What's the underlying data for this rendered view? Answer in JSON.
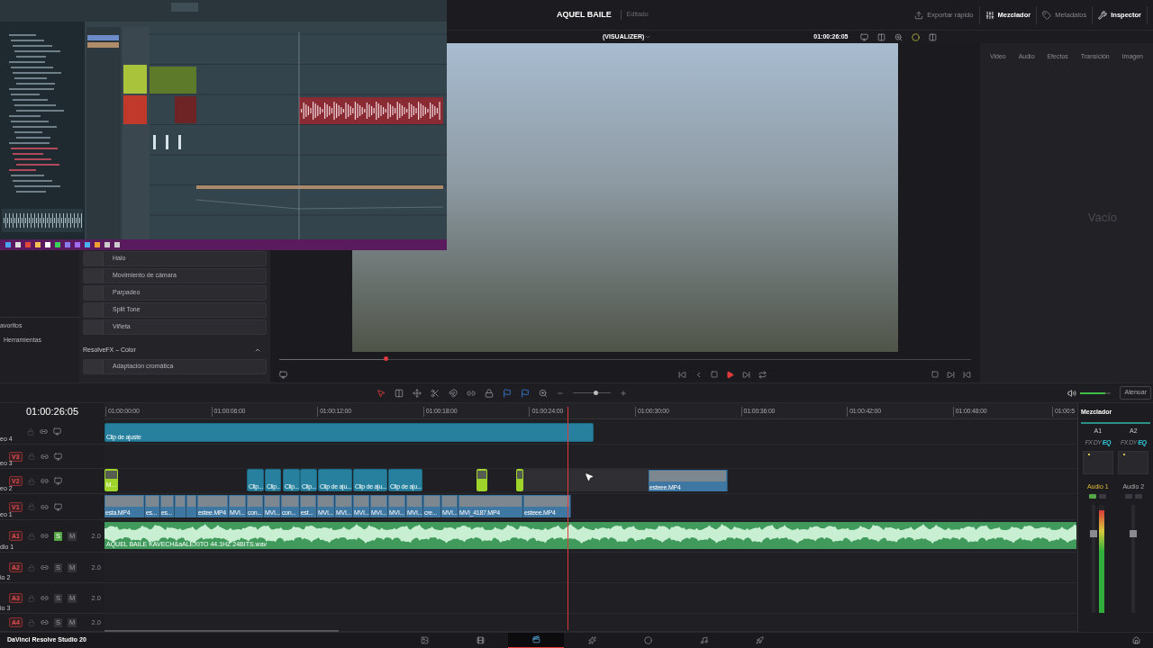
{
  "project": {
    "title": "AQUEL BAILE",
    "status": "Editado"
  },
  "header_buttons": [
    {
      "kind": "export",
      "label": "Exportar rápido",
      "selected": false
    },
    {
      "kind": "mixer",
      "label": "Mezclador",
      "selected": true
    },
    {
      "kind": "metadata",
      "label": "Metadatos",
      "selected": false
    },
    {
      "kind": "inspector",
      "label": "Inspector",
      "selected": true
    }
  ],
  "viewer": {
    "title": "(VISUALIZER)",
    "timecode": "01:00:26:05",
    "scrub": {
      "level": 0.154
    }
  },
  "sidebar": [
    "avoritos",
    "Herramientas"
  ],
  "effects": {
    "items": [
      "Halo",
      "Movimiento de cámara",
      "Parpadeo",
      "Split Tone",
      "Viñeta"
    ],
    "section": "ResolveFX – Color",
    "section_items": [
      "Adaptación cromática"
    ]
  },
  "inspector": {
    "tabs": [
      "Video",
      "Audio",
      "Efectos",
      "Transición",
      "Imagen"
    ],
    "empty_text": "Vacío"
  },
  "toolbar": {
    "tools": [
      {
        "kind": "select",
        "selected": true
      },
      {
        "kind": "trim",
        "selected": false
      },
      {
        "kind": "dynamic",
        "selected": false
      },
      {
        "kind": "blade",
        "selected": false
      }
    ],
    "zoom": {
      "level": 0.6
    },
    "volume": {
      "level": 0.8
    },
    "dim_button": "Atenuar"
  },
  "timeline": {
    "timecode": "01:00:26:05",
    "ruler": [
      "01:00:00:00",
      "01:00:06:00",
      "01:00:12:00",
      "01:00:18:00",
      "01:00:24:00",
      "01:00:30:00",
      "01:00:36:00",
      "01:00:42:00",
      "01:00:48:00",
      "01:00:5"
    ],
    "tracks": [
      {
        "kind": "video",
        "name": "eo 4",
        "clips": [
          {
            "kind": "adjustment",
            "label": "Clip de ajuste"
          }
        ]
      },
      {
        "kind": "video",
        "id": "V3",
        "name": "eo 3"
      },
      {
        "kind": "video",
        "id": "V2",
        "name": "eo 2",
        "clips": [
          {
            "kind": "still",
            "label": "M..."
          },
          {
            "kind": "adjustment",
            "label": "Clip..."
          },
          {
            "kind": "adjustment",
            "label": "Clip..."
          },
          {
            "kind": "adjustment",
            "label": "Clip..."
          },
          {
            "kind": "adjustment",
            "label": "Clip..."
          },
          {
            "kind": "adjustment",
            "label": "Clip de aju..."
          },
          {
            "kind": "adjustment",
            "label": "Clip de aju..."
          },
          {
            "kind": "adjustment",
            "label": "Clip de aju..."
          },
          {
            "kind": "still"
          },
          {
            "kind": "still"
          },
          {
            "kind": "video",
            "label": "esteee.MP4"
          }
        ]
      },
      {
        "kind": "video",
        "id": "V1",
        "name": "eo 1",
        "clips": [
          {
            "kind": "video",
            "label": "esta.MP4"
          },
          {
            "kind": "video",
            "label": "es..."
          },
          {
            "kind": "video",
            "label": "es..."
          },
          {
            "kind": "video"
          },
          {
            "kind": "video"
          },
          {
            "kind": "video",
            "label": "estee.MP4"
          },
          {
            "kind": "video",
            "label": "MVI..."
          },
          {
            "kind": "video",
            "label": "con..."
          },
          {
            "kind": "video",
            "label": "MVI..."
          },
          {
            "kind": "video",
            "label": "con..."
          },
          {
            "kind": "video",
            "label": "est..."
          },
          {
            "kind": "video",
            "label": "MVI..."
          },
          {
            "kind": "video",
            "label": "MVI..."
          },
          {
            "kind": "video",
            "label": "MVI..."
          },
          {
            "kind": "video",
            "label": "MVI..."
          },
          {
            "kind": "video",
            "label": "MVI..."
          },
          {
            "kind": "video",
            "label": "MVI..."
          },
          {
            "kind": "video",
            "label": "cre..."
          },
          {
            "kind": "video",
            "label": "MVI..."
          },
          {
            "kind": "video",
            "label": "MVI_4187.MP4"
          },
          {
            "kind": "video",
            "label": "esteee.MP4"
          }
        ]
      },
      {
        "kind": "audio",
        "id": "A1",
        "name": "dio 1",
        "solo": true,
        "mute": false,
        "solo_label": "S",
        "mute_label": "M",
        "channels": "2.0",
        "clips": [
          {
            "kind": "audio",
            "label": "AQUEL BAILE KAVECH&aALEXITO 44.1HZ 24BITS.wav"
          }
        ]
      },
      {
        "kind": "audio",
        "id": "A2",
        "name": "io 2",
        "solo": false,
        "mute": false,
        "solo_label": "S",
        "mute_label": "M",
        "channels": "2.0"
      },
      {
        "kind": "audio",
        "id": "A3",
        "name": "io 3",
        "solo": false,
        "mute": false,
        "solo_label": "S",
        "mute_label": "M",
        "channels": "2.0"
      },
      {
        "kind": "audio",
        "id": "A4",
        "solo": false,
        "mute": false,
        "solo_label": "S",
        "mute_label": "M",
        "channels": "2.0"
      }
    ]
  },
  "mixer": {
    "title": "Mezclador",
    "channels": [
      {
        "name": "A1",
        "label": "Audio 1",
        "selected": true,
        "fx": [
          {
            "label": "FX",
            "on": false
          },
          {
            "label": "DY",
            "on": false
          },
          {
            "label": "EQ",
            "on": true
          }
        ],
        "toggles": [
          {
            "on": true
          },
          {
            "on": false
          }
        ],
        "meter": {
          "level": 0.95
        }
      },
      {
        "name": "A2",
        "label": "Audio 2",
        "selected": false,
        "fx": [
          {
            "label": "FX",
            "on": false
          },
          {
            "label": "DY",
            "on": false
          },
          {
            "label": "EQ",
            "on": true
          }
        ],
        "toggles": [
          {
            "on": false
          },
          {
            "on": false
          }
        ]
      }
    ]
  },
  "app_name": "DaVinci Resolve Studio 20",
  "pages": [
    {
      "kind": "media",
      "selected": false
    },
    {
      "kind": "cut",
      "selected": false
    },
    {
      "kind": "edit",
      "selected": true
    },
    {
      "kind": "fusion",
      "selected": false
    },
    {
      "kind": "color",
      "selected": false
    },
    {
      "kind": "fairlight",
      "selected": false
    },
    {
      "kind": "deliver",
      "selected": false
    }
  ]
}
